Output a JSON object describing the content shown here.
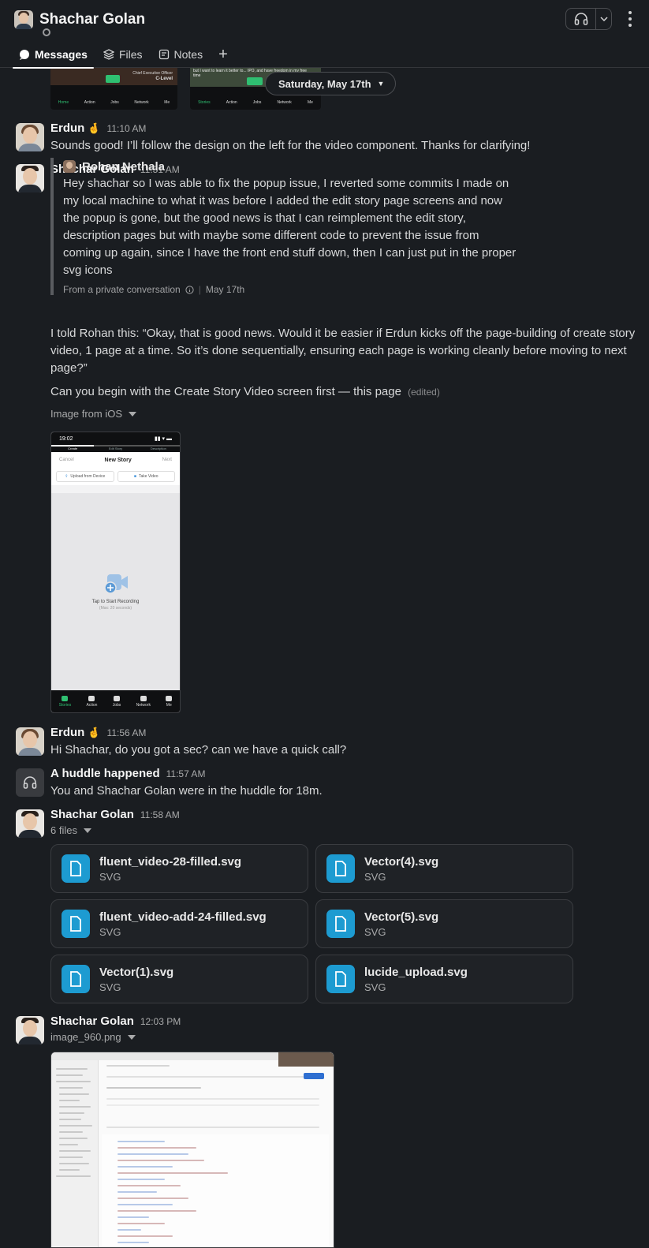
{
  "header": {
    "title": "Shachar Golan",
    "tabs": [
      {
        "label": "Messages",
        "icon": "message-bubble-icon",
        "active": true
      },
      {
        "label": "Files",
        "icon": "layers-icon",
        "active": false
      },
      {
        "label": "Notes",
        "icon": "note-icon",
        "active": false
      }
    ],
    "add_tab": "+"
  },
  "date_divider": "Saturday, May 17th",
  "top_images": {
    "left": {
      "caption_line1": "Chief Executive Officer",
      "caption_line2": "C-Level",
      "nav": [
        "Home",
        "Action",
        "Jobs",
        "Network",
        "Me"
      ]
    },
    "right": {
      "caption": "but I want to learn it better to... IPO, and have freedom in my free time",
      "nav": [
        "Stories",
        "Action",
        "Jobs",
        "Network",
        "Me"
      ]
    }
  },
  "messages": [
    {
      "author": "Erdun",
      "emoji": "🤞",
      "time": "11:10 AM",
      "text": "Sounds good! I’ll follow the design on the left for the video component. Thanks for clarifying!"
    },
    {
      "author": "Shachar Golan",
      "time": "11:51 AM",
      "quote": {
        "author": "Rohan Nethala",
        "lines": [
          "Hey shachar so I was able to fix the popup issue, I reverted some commits I made on",
          "my local machine to what it was before I added the edit story page screens and now",
          "the popup is gone, but the good news is that I can reimplement the edit story,",
          "description pages but with maybe some different code to prevent the issue from",
          "coming up again, since I have the front end stuff down, then I can just put in the proper",
          "svg icons"
        ],
        "source": "From a private conversation",
        "date": "May 17th"
      },
      "text_lines": [
        "I told Rohan this: “Okay, that is good news. Would it be easier if Erdun kicks off the page-building of create story",
        "video, 1 page at a time. So it’s done sequentially, ensuring each page is working cleanly before moving to next",
        "page?”"
      ],
      "text2": "Can you begin with the Create Story Video screen first — this page",
      "edited": "(edited)",
      "image_label": "Image from iOS",
      "phone": {
        "time": "19:02",
        "steps": [
          "Create",
          "Edit Story",
          "Description"
        ],
        "cancel": "Cancel",
        "title": "New Story",
        "next": "Next",
        "upload": "Upload from Device",
        "take_video": "Take Video",
        "record_title": "Tap to Start Recording",
        "record_sub": "(Max: 20 seconds)",
        "nav": [
          "Stories",
          "Action",
          "Jobs",
          "Network",
          "Me"
        ]
      }
    },
    {
      "author": "Erdun",
      "emoji": "🤞",
      "time": "11:56 AM",
      "text": "Hi Shachar, do you got a sec? can we have a quick call?"
    },
    {
      "author": "A huddle happened",
      "time": "11:57 AM",
      "text": "You and Shachar Golan were in the huddle for 18m."
    },
    {
      "author": "Shachar Golan",
      "time": "11:58 AM",
      "files_label": "6 files",
      "files": [
        {
          "name": "fluent_video-28-filled.svg",
          "type": "SVG"
        },
        {
          "name": "Vector(4).svg",
          "type": "SVG"
        },
        {
          "name": "fluent_video-add-24-filled.svg",
          "type": "SVG"
        },
        {
          "name": "Vector(5).svg",
          "type": "SVG"
        },
        {
          "name": "Vector(1).svg",
          "type": "SVG"
        },
        {
          "name": "lucide_upload.svg",
          "type": "SVG"
        }
      ]
    },
    {
      "author": "Shachar Golan",
      "time": "12:03 PM",
      "image_label": "image_960.png"
    }
  ],
  "colors": {
    "background": "#1a1d21",
    "file_icon": "#1d9bd1",
    "active_green": "#2fbf71"
  }
}
